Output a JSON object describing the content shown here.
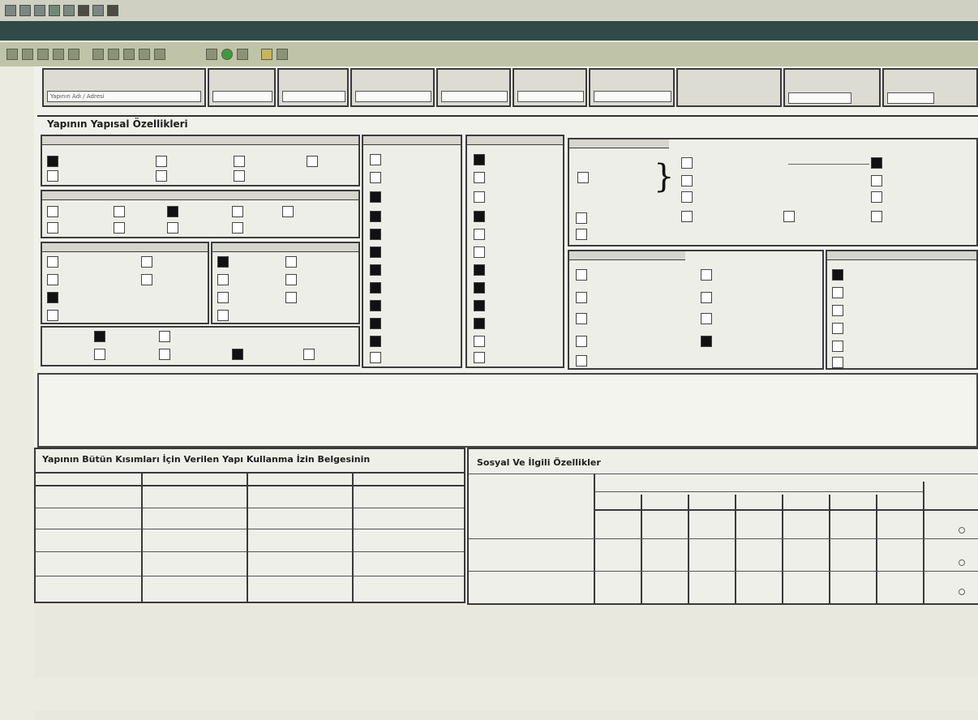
{
  "window": {
    "title": "",
    "accent": "#2f4a48",
    "toolbar_label": ""
  },
  "form": {
    "section1_title": "Yapının Yapısal Özellikleri",
    "section2_title": "Yapının Bütün Kısımları İçin Verilen Yapı Kullanma İzin Belgesinin",
    "section3_title": "Sosyal Ve İlgili Özellikler",
    "header_fields": [
      {
        "label": "Yapının Adı / Adresi",
        "value": "",
        "value2": ""
      },
      {
        "label": "",
        "value": ""
      },
      {
        "label": "",
        "value": ""
      },
      {
        "label": "",
        "value": ""
      }
    ],
    "groups": {
      "g1": "",
      "g2": "",
      "g3": "",
      "g4": "",
      "g5": "",
      "g6": "",
      "g7": "",
      "g8": ""
    },
    "paragraph": "",
    "table_left_headers": [
      "",
      "",
      "",
      ""
    ],
    "table_right_header": "",
    "table_right_rows": [
      "",
      "",
      ""
    ]
  },
  "statusbar": {
    "items": [
      "",
      "",
      "",
      ""
    ]
  }
}
